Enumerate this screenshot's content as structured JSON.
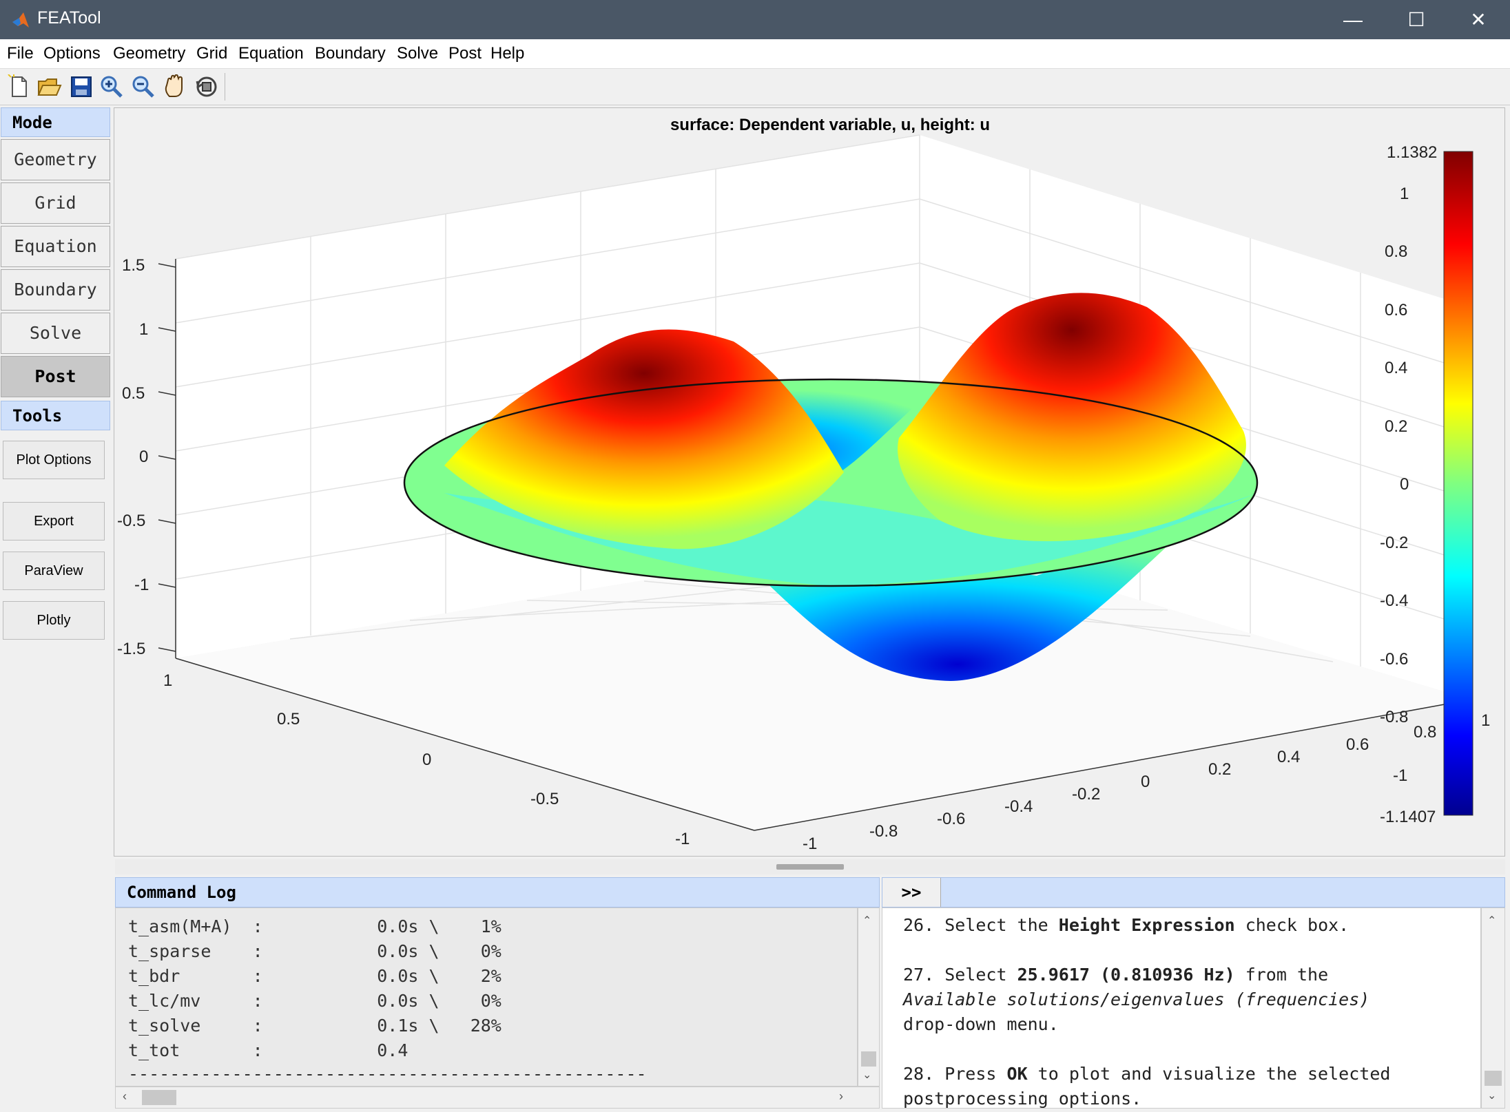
{
  "window": {
    "title": "FEATool",
    "minimize": "—",
    "maximize": "☐",
    "close": "✕"
  },
  "menu": [
    "File",
    "Options",
    "Geometry",
    "Grid",
    "Equation",
    "Boundary",
    "Solve",
    "Post",
    "Help"
  ],
  "toolbar": [
    "new-file-icon",
    "open-folder-icon",
    "save-icon",
    "zoom-in-icon",
    "zoom-out-icon",
    "pan-hand-icon",
    "rotate-icon"
  ],
  "sidebar": {
    "mode_header": "Mode",
    "modes": [
      "Geometry",
      "Grid",
      "Equation",
      "Boundary",
      "Solve",
      "Post"
    ],
    "active_mode": "Post",
    "tools_header": "Tools",
    "tools": [
      "Plot Options",
      "Export",
      "ParaView",
      "Plotly"
    ]
  },
  "plot": {
    "title": "surface: Dependent variable, u, height: u",
    "z_ticks": [
      "1.5",
      "1",
      "0.5",
      "0",
      "-0.5",
      "-1",
      "-1.5"
    ],
    "y_ticks": [
      "1",
      "0.5",
      "0",
      "-0.5",
      "-1"
    ],
    "x_ticks": [
      "-1",
      "-0.8",
      "-0.6",
      "-0.4",
      "-0.2",
      "0",
      "0.2",
      "0.4",
      "0.6",
      "0.8",
      "1"
    ],
    "colorbar": {
      "max_label": "1.1382",
      "min_label": "-1.1407",
      "ticks": [
        "1",
        "0.8",
        "0.6",
        "0.4",
        "0.2",
        "0",
        "-0.2",
        "-0.4",
        "-0.6",
        "-0.8",
        "-1"
      ],
      "colors": [
        "#00008f",
        "#0000ff",
        "#0080ff",
        "#00ffff",
        "#80ff80",
        "#ffff00",
        "#ff8000",
        "#ff0000",
        "#800000"
      ]
    }
  },
  "log": {
    "title": "Command Log",
    "expand": ">>",
    "lines": [
      "t_asm(M+A)  :           0.0s \\    1%",
      "t_sparse    :           0.0s \\    0%",
      "t_bdr       :           0.0s \\    2%",
      "t_lc/mv     :           0.0s \\    0%",
      "t_solve     :           0.1s \\   28%",
      "t_tot       :           0.4",
      "--------------------------------------------------"
    ]
  },
  "help": {
    "step26_pre": "26. Select the ",
    "step26_bold": "Height Expression",
    "step26_post": " check box.",
    "step27_pre": "27. Select ",
    "step27_bold": "25.9617 (0.810936 Hz)",
    "step27_post": " from the",
    "step27_italic": "Available solutions/eigenvalues (frequencies)",
    "step27_end": "drop-down menu.",
    "step28_pre": "28. Press ",
    "step28_bold": "OK",
    "step28_post": " to plot and visualize the selected",
    "step28_end": "postprocessing options."
  }
}
